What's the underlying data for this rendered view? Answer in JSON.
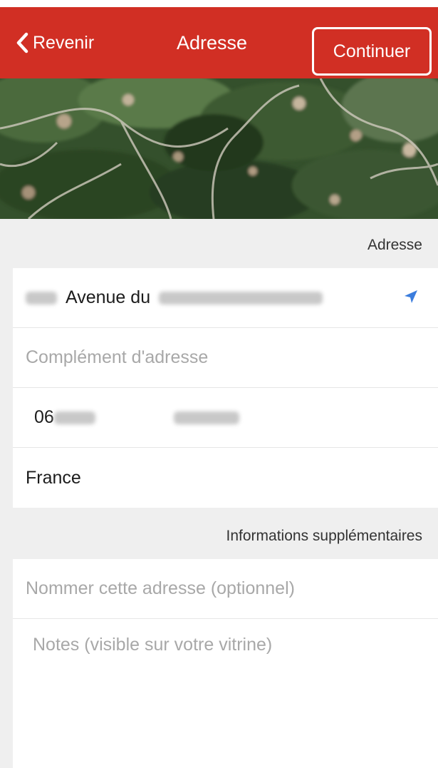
{
  "navbar": {
    "back_label": "Revenir",
    "title": "Adresse",
    "continue_label": "Continuer",
    "background_color": "#d12f24"
  },
  "address_section": {
    "header": "Adresse",
    "street_visible": "Avenue du",
    "complement_placeholder": "Complément d'adresse",
    "postal_code_visible": "06",
    "country": "France"
  },
  "extra_section": {
    "header": "Informations supplémentaires",
    "name_placeholder": "Nommer cette adresse (optionnel)",
    "notes_placeholder": "Notes (visible sur votre vitrine)"
  },
  "icons": {
    "back": "chevron-left-icon",
    "location": "location-arrow-icon"
  },
  "colors": {
    "accent_blue": "#3b7ddd"
  }
}
